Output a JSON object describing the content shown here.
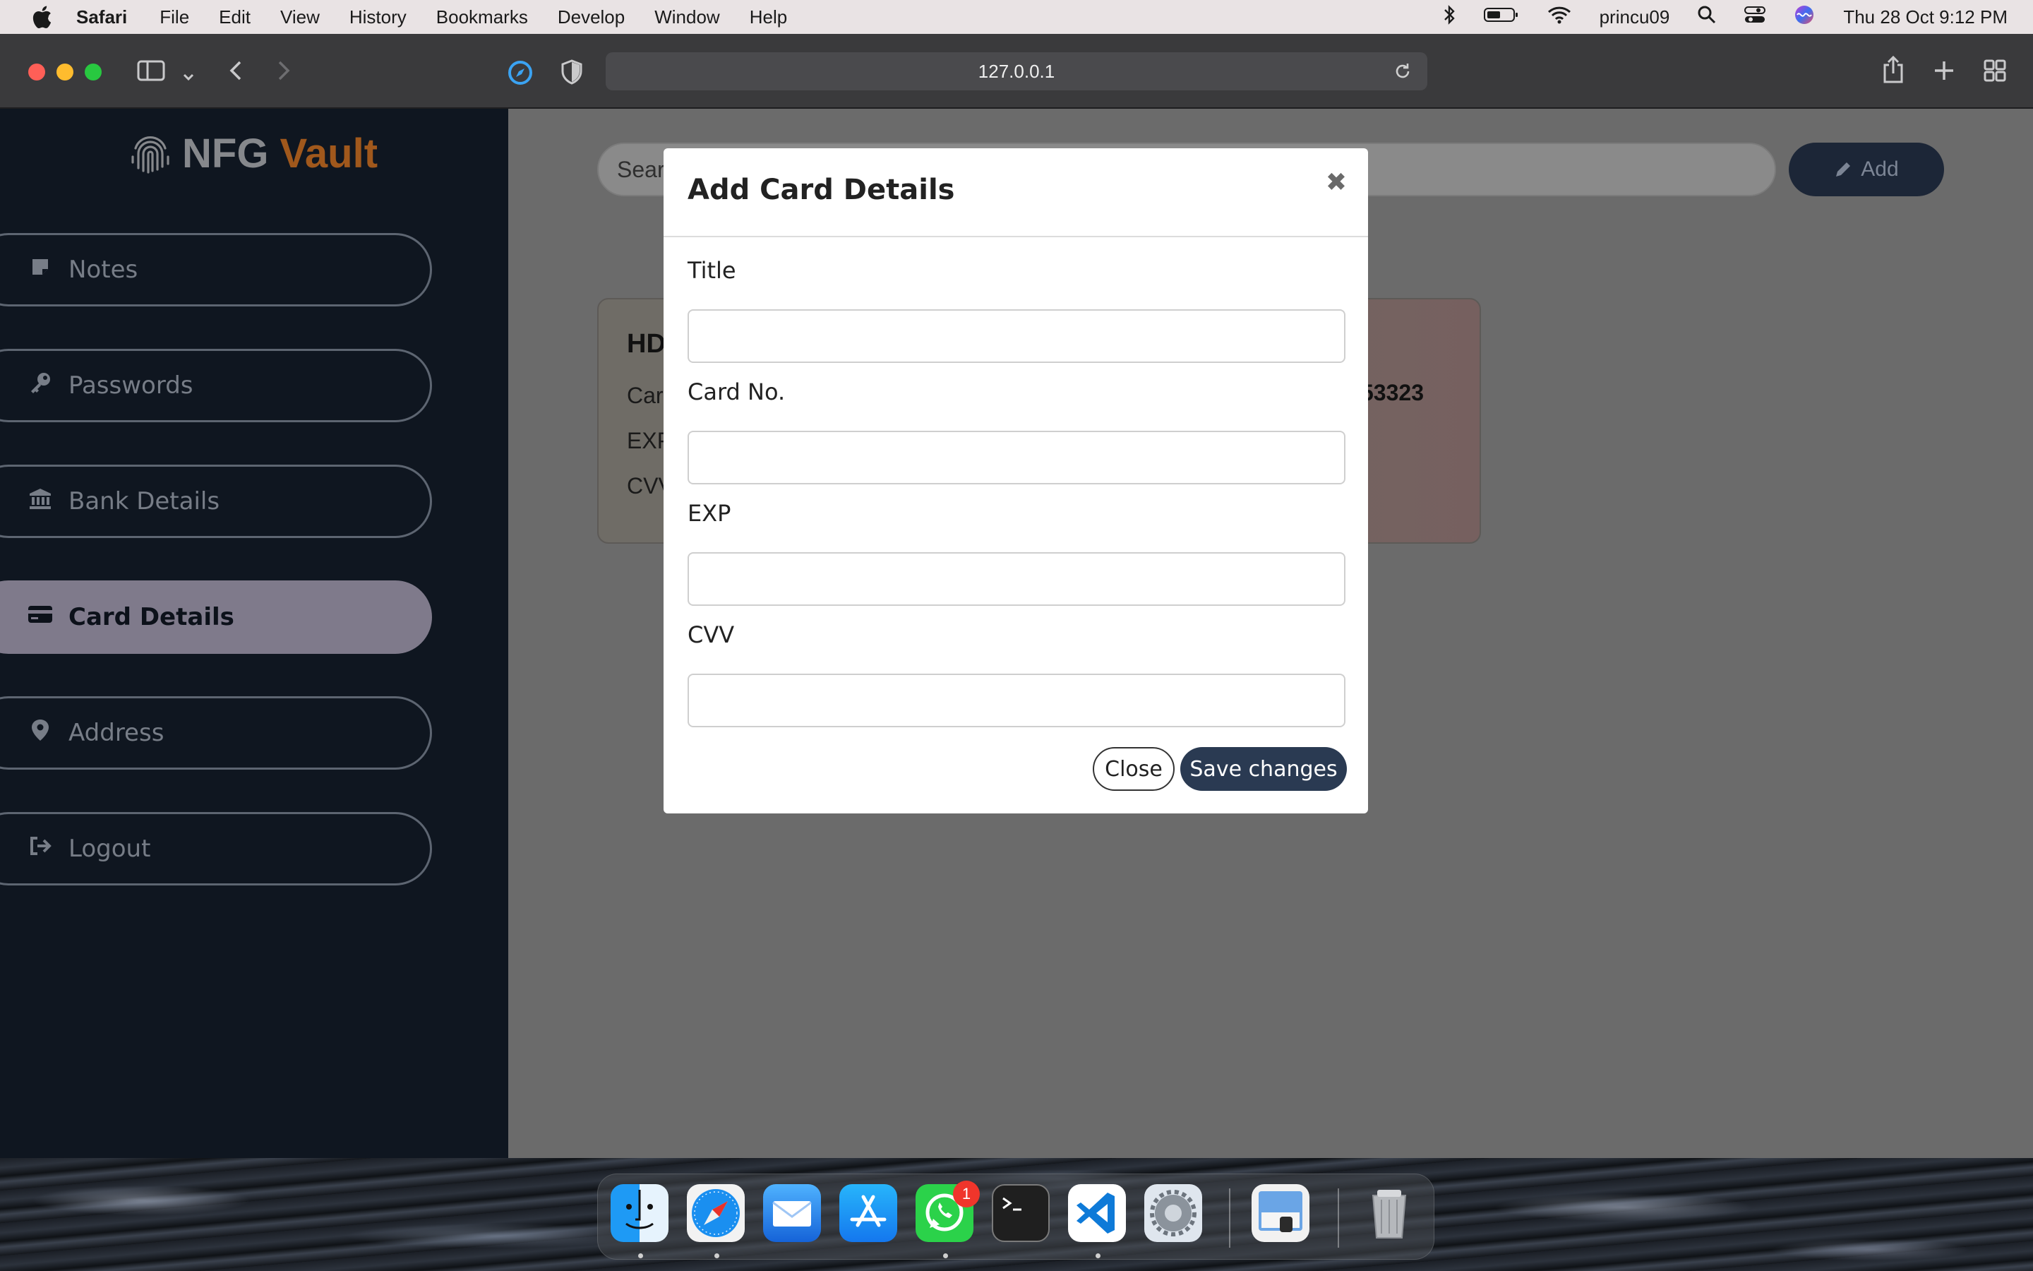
{
  "menubar": {
    "app_name": "Safari",
    "items": [
      "File",
      "Edit",
      "View",
      "History",
      "Bookmarks",
      "Develop",
      "Window",
      "Help"
    ],
    "user": "princu09",
    "datetime": "Thu 28 Oct  9:12 PM"
  },
  "browser": {
    "url": "127.0.0.1"
  },
  "sidebar": {
    "brand_main": "NFG",
    "brand_accent": "Vault",
    "items": [
      {
        "label": "Notes",
        "icon": "note-icon"
      },
      {
        "label": "Passwords",
        "icon": "key-icon"
      },
      {
        "label": "Bank Details",
        "icon": "bank-icon"
      },
      {
        "label": "Card Details",
        "icon": "credit-card-icon",
        "active": true
      },
      {
        "label": "Address",
        "icon": "map-pin-icon"
      },
      {
        "label": "Logout",
        "icon": "logout-icon"
      }
    ]
  },
  "main": {
    "search_placeholder": "Sear",
    "add_label": "Add",
    "card": {
      "title": "HD",
      "line1": "Car",
      "line2": "EXP",
      "line3": "CVV",
      "number_fragment": "53323"
    }
  },
  "modal": {
    "title": "Add Card Details",
    "fields": [
      {
        "label": "Title",
        "value": ""
      },
      {
        "label": "Card No.",
        "value": ""
      },
      {
        "label": "EXP",
        "value": ""
      },
      {
        "label": "CVV",
        "value": ""
      }
    ],
    "close_label": "Close",
    "save_label": "Save changes"
  },
  "dock": {
    "apps": [
      "Finder",
      "Safari",
      "Mail",
      "App Store",
      "WhatsApp",
      "Terminal",
      "Visual Studio Code",
      "System Preferences",
      "Preview",
      "Trash"
    ],
    "whatsapp_badge": "1"
  },
  "colors": {
    "sidebar_bg": "#0f1620",
    "brand_accent": "#a0581c",
    "active_item": "#7f7a8b",
    "primary_button": "#2a3a52"
  }
}
